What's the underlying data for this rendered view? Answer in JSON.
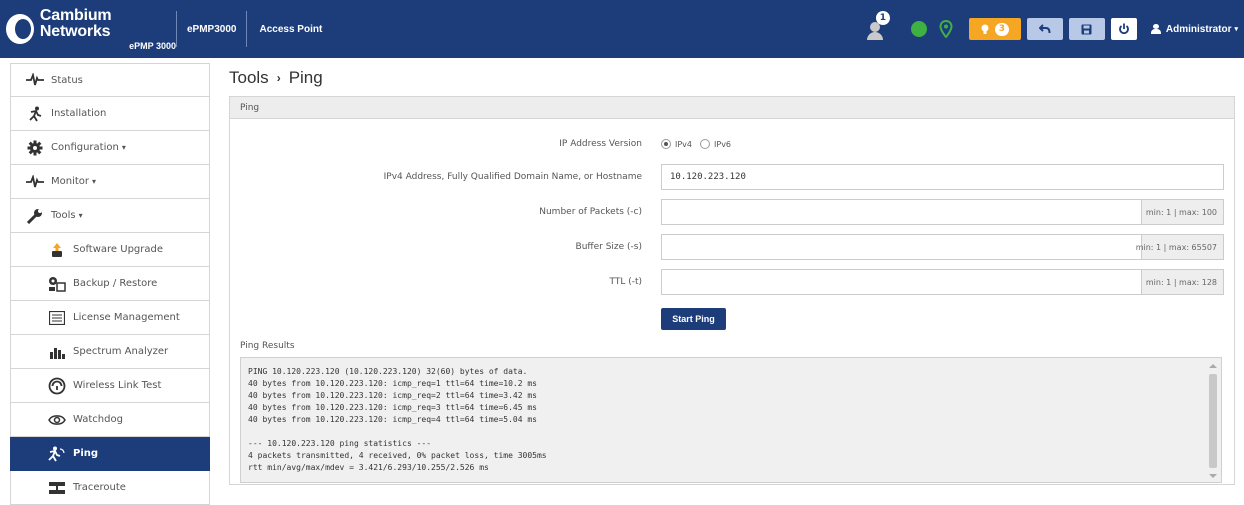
{
  "header": {
    "brand": "Cambium Networks",
    "model": "ePMP 3000",
    "device": "ePMP3000",
    "mode": "Access Point",
    "notifications_count": "1",
    "alarms_count": "3",
    "user": "Administrator"
  },
  "sidebar": {
    "items": [
      {
        "label": "Status",
        "icon": "pulse-icon"
      },
      {
        "label": "Installation",
        "icon": "runner-icon"
      },
      {
        "label": "Configuration",
        "icon": "gear-icon"
      },
      {
        "label": "Monitor",
        "icon": "pulse-icon"
      },
      {
        "label": "Tools",
        "icon": "wrench-icon"
      },
      {
        "label": "Software Upgrade",
        "icon": "upgrade-icon"
      },
      {
        "label": "Backup / Restore",
        "icon": "backup-icon"
      },
      {
        "label": "License Management",
        "icon": "license-icon"
      },
      {
        "label": "Spectrum Analyzer",
        "icon": "bar-chart-icon"
      },
      {
        "label": "Wireless Link Test",
        "icon": "speedometer-icon"
      },
      {
        "label": "Watchdog",
        "icon": "eye-icon"
      },
      {
        "label": "Ping",
        "icon": "ping-icon"
      },
      {
        "label": "Traceroute",
        "icon": "traceroute-icon"
      }
    ]
  },
  "page": {
    "breadcrumb_parent": "Tools",
    "breadcrumb_current": "Ping",
    "panel_title": "Ping"
  },
  "form": {
    "ip_version_label": "IP Address Version",
    "ipv4_label": "IPv4",
    "ipv6_label": "IPv6",
    "ip_version_selected": "IPv4",
    "address_label": "IPv4 Address, Fully Qualified Domain Name, or Hostname",
    "address_value": "10.120.223.120",
    "packets_label": "Number of Packets (-c)",
    "packets_hint": "min: 1 | max: 100",
    "buffer_label": "Buffer Size (-s)",
    "buffer_hint": "min: 1 | max: 65507",
    "ttl_label": "TTL (-t)",
    "ttl_hint": "min: 1 | max: 128",
    "start_button": "Start Ping"
  },
  "results": {
    "label": "Ping Results",
    "text": "PING 10.120.223.120 (10.120.223.120) 32(60) bytes of data.\n40 bytes from 10.120.223.120: icmp_req=1 ttl=64 time=10.2 ms\n40 bytes from 10.120.223.120: icmp_req=2 ttl=64 time=3.42 ms\n40 bytes from 10.120.223.120: icmp_req=3 ttl=64 time=6.45 ms\n40 bytes from 10.120.223.120: icmp_req=4 ttl=64 time=5.04 ms\n\n--- 10.120.223.120 ping statistics ---\n4 packets transmitted, 4 received, 0% packet loss, time 3005ms\nrtt min/avg/max/mdev = 3.421/6.293/10.255/2.526 ms"
  },
  "colors": {
    "header_bg": "#1d3d7a",
    "active_nav": "#1d3d7a",
    "alarm": "#f5a623",
    "status_ok": "#3fb044"
  }
}
